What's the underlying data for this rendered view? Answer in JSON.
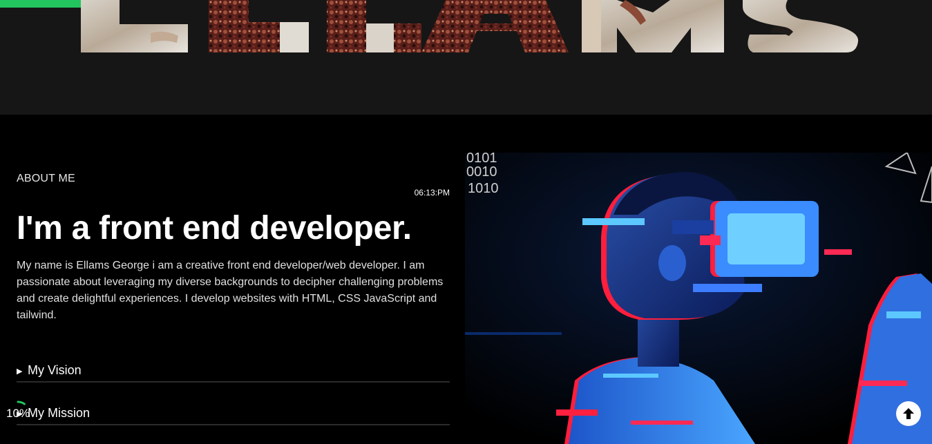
{
  "hero": {
    "title": "ELLAMS",
    "accent_color": "#22c55e"
  },
  "about": {
    "label": "ABOUT ME",
    "clock": "06:13:PM",
    "headline": "I'm a front end developer.",
    "bio": "My name is Ellams George i am a creative front end developer/web developer. I am passionate about leveraging my diverse backgrounds to decipher challenging problems and create delightful experiences. I develop websites with HTML, CSS JavaScript and tailwind.",
    "accordion": [
      {
        "label": "My Vision",
        "icon": "triangle-right-icon"
      },
      {
        "label": "My Mission",
        "icon": "triangle-right-icon"
      }
    ]
  },
  "scroll_progress": {
    "text": "10%",
    "fraction": 0.1,
    "color": "#22c55e"
  },
  "image": {
    "binary_lines": [
      "0101",
      "0010",
      "1010"
    ]
  },
  "back_to_top": {
    "icon": "arrow-up-icon"
  }
}
